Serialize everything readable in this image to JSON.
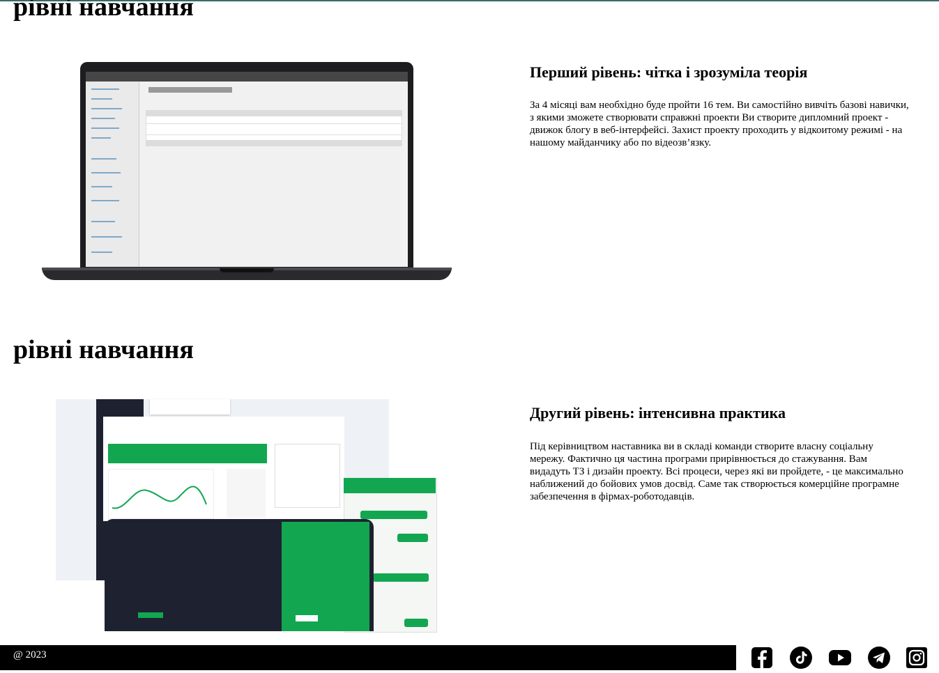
{
  "sections": [
    {
      "title": "рівні навчання",
      "heading": "Перший рівень: чітка і зрозуміла теорія",
      "text": "За 4 місяці вам необхідно буде пройти 16 тем. Ви самостійно вивчіть базові навички, з якими зможете створювати справжні проекти Ви створите дипломний проект - движок блогу в веб-інтерфейсі. Захист проекту проходить у відкоитому режимі - на нашому майданчику або по відеозв’язку."
    },
    {
      "title": "рівні навчання",
      "heading": "Другий рівень: інтенсивна практика",
      "text": "Під керівництвом наставника ви в складі команди створите власну соціальну мережу. Фактично ця частина програми прирівнюється до стажування. Вам видадуть ТЗ і дизайн проекту. Всі процеси, через які ви пройдете, - це максимально наближений до бойових умов досвід. Саме так створюється комерційне програмне забезпечення в фірмах-роботодавців."
    }
  ],
  "footer": {
    "copyright": "@ 2023",
    "social_icons": [
      "facebook-icon",
      "tiktok-icon",
      "youtube-icon",
      "telegram-icon",
      "instagram-icon"
    ]
  },
  "colors": {
    "footer_bg": "#000000",
    "accent_green": "#12a651",
    "text": "#000000"
  }
}
